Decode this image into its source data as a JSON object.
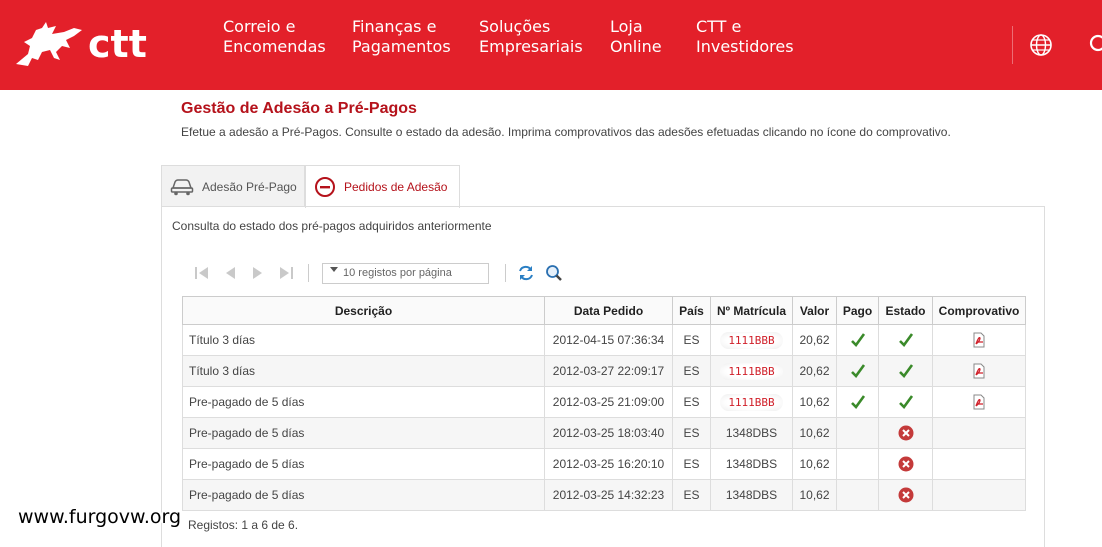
{
  "brand": {
    "name": "ctt",
    "color": "#e3202a"
  },
  "nav": [
    {
      "label": "Correio e\nEncomendas"
    },
    {
      "label": "Finanças e\nPagamentos"
    },
    {
      "label": "Soluções\nEmpresariais"
    },
    {
      "label": "Loja\nOnline"
    },
    {
      "label": "CTT e\nInvestidores"
    }
  ],
  "header_icons": [
    "globe-icon",
    "search-icon"
  ],
  "page": {
    "title": "Gestão de Adesão a Pré-Pagos",
    "subtitle": "Efetue a adesão a Pré-Pagos. Consulte o estado da adesão. Imprima comprovativos das adesões efetuadas clicando no ícone do comprovativo."
  },
  "tabs": [
    {
      "label": "Adesão Pré-Pago",
      "icon": "car-icon",
      "active": false
    },
    {
      "label": "Pedidos de Adesão",
      "icon": "minus-circle-icon",
      "active": true
    }
  ],
  "panel": {
    "description": "Consulta do estado dos pré-pagos adquiridos anteriormente",
    "page_size_placeholder": "10 registos por página"
  },
  "table": {
    "columns": [
      "Descrição",
      "Data Pedido",
      "País",
      "Nº Matrícula",
      "Valor",
      "Pago",
      "Estado",
      "Comprovativo"
    ],
    "rows": [
      {
        "desc": "Título 3 días",
        "date": "2012-04-15 07:36:34",
        "country": "ES",
        "plate": "1111BBB",
        "plate_style": "red",
        "value": "20,62",
        "paid": true,
        "state": "ok",
        "receipt": true
      },
      {
        "desc": "Título 3 días",
        "date": "2012-03-27 22:09:17",
        "country": "ES",
        "plate": "1111BBB",
        "plate_style": "red",
        "value": "20,62",
        "paid": true,
        "state": "ok",
        "receipt": true
      },
      {
        "desc": "Pre-pagado de 5 días",
        "date": "2012-03-25 21:09:00",
        "country": "ES",
        "plate": "1111BBB",
        "plate_style": "red",
        "value": "10,62",
        "paid": true,
        "state": "ok",
        "receipt": true
      },
      {
        "desc": "Pre-pagado de 5 días",
        "date": "2012-03-25 18:03:40",
        "country": "ES",
        "plate": "1348DBS",
        "plate_style": "plain",
        "value": "10,62",
        "paid": false,
        "state": "error",
        "receipt": false
      },
      {
        "desc": "Pre-pagado de 5 días",
        "date": "2012-03-25 16:20:10",
        "country": "ES",
        "plate": "1348DBS",
        "plate_style": "plain",
        "value": "10,62",
        "paid": false,
        "state": "error",
        "receipt": false
      },
      {
        "desc": "Pre-pagado de 5 días",
        "date": "2012-03-25 14:32:23",
        "country": "ES",
        "plate": "1348DBS",
        "plate_style": "plain",
        "value": "10,62",
        "paid": false,
        "state": "error",
        "receipt": false
      }
    ]
  },
  "footer": {
    "count_text": "Registos: 1 a 6 de 6."
  },
  "watermark": "www.furgovw.org"
}
